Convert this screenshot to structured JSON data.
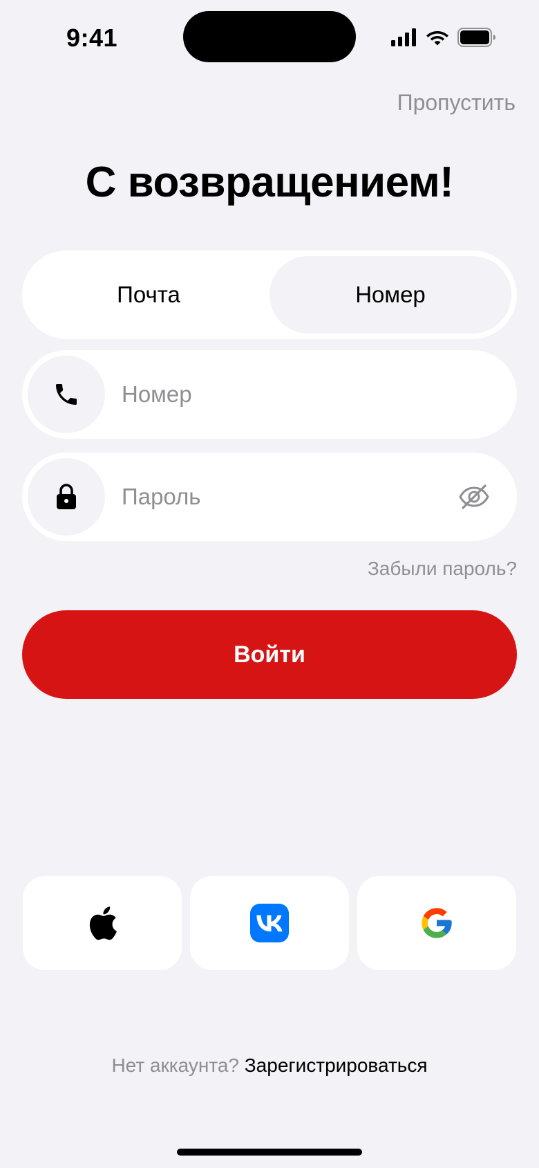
{
  "status_bar": {
    "time": "9:41"
  },
  "header": {
    "skip_label": "Пропустить",
    "title": "С возвращением!"
  },
  "segmented": {
    "options": [
      "Почта",
      "Номер"
    ],
    "selected": "Номер"
  },
  "form": {
    "phone_placeholder": "Номер",
    "phone_value": "",
    "password_placeholder": "Пароль",
    "password_value": "",
    "forgot_label": "Забыли пароль?",
    "submit_label": "Войти"
  },
  "social": {
    "providers": [
      "apple-icon",
      "vk-icon",
      "google-icon"
    ]
  },
  "footer": {
    "prompt": "Нет аккаунта?",
    "register_label": "Зарегистрироваться"
  },
  "colors": {
    "background": "#F2F2F7",
    "accent": "#D71414",
    "muted_text": "#8E8E93",
    "vk_brand": "#0077FF"
  }
}
